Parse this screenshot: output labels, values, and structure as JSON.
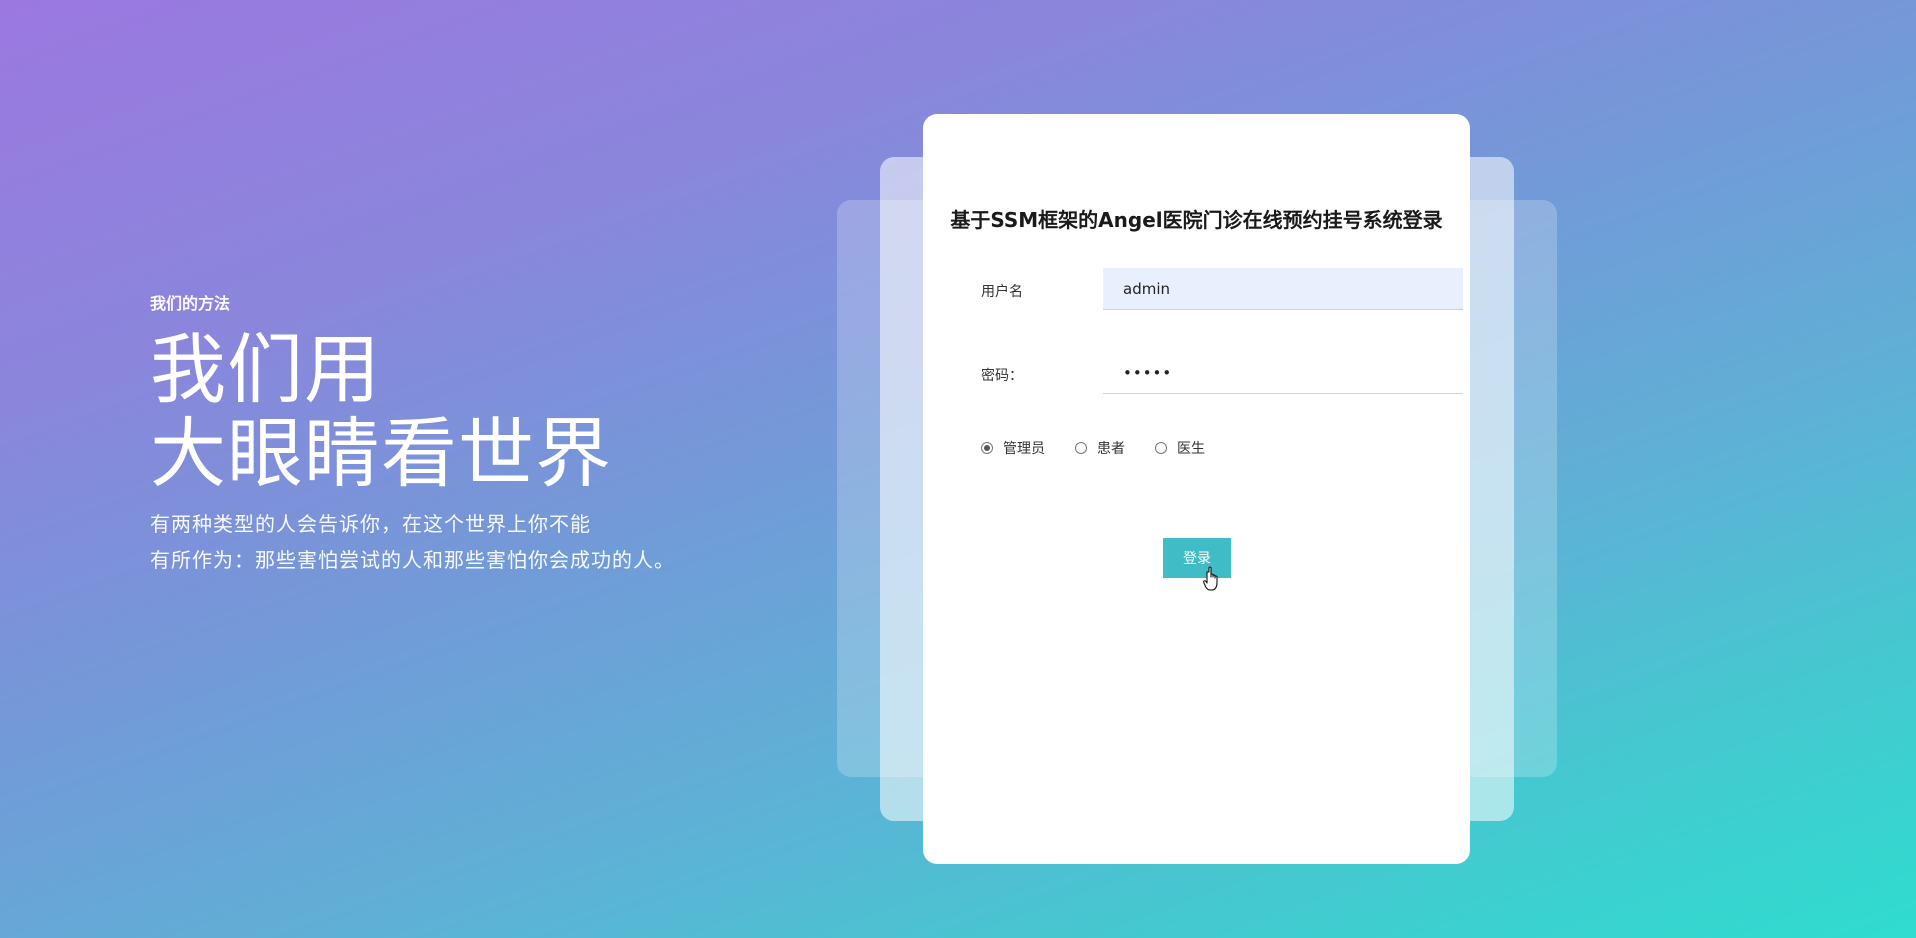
{
  "hero": {
    "eyebrow": "我们的方法",
    "headline_line1": "我们用",
    "headline_line2": "大眼睛看世界",
    "desc_line1": "有两种类型的人会告诉你，在这个世界上你不能",
    "desc_line2": "有所作为：那些害怕尝试的人和那些害怕你会成功的人。"
  },
  "login": {
    "title": "基于SSM框架的Angel医院门诊在线预约挂号系统登录",
    "username_label": "用户名",
    "username_value": "admin",
    "password_label": "密码：",
    "password_value": "•••••",
    "roles": [
      {
        "label": "管理员",
        "checked": true
      },
      {
        "label": "患者",
        "checked": false
      },
      {
        "label": "医生",
        "checked": false
      }
    ],
    "submit_label": "登录"
  },
  "colors": {
    "accent": "#3fbcc6",
    "username_bg": "#e8f0fe"
  },
  "icons": {
    "cursor": "hand-pointer-icon"
  }
}
